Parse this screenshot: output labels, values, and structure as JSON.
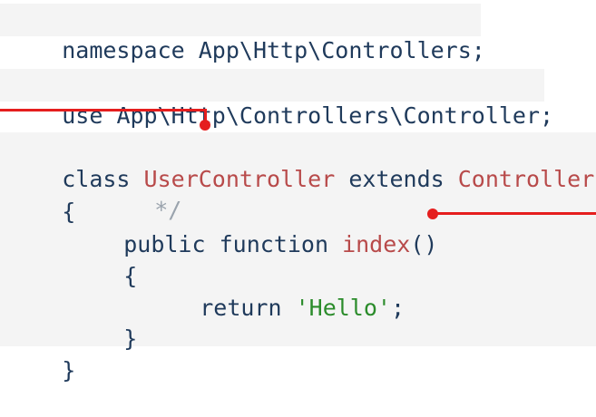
{
  "code": {
    "namespace_line": {
      "keyword": "namespace",
      "path": "App\\Http\\Controllers;"
    },
    "use_line": {
      "keyword": "use",
      "path": "App\\Http\\Controllers\\Controller;"
    },
    "class_line": {
      "keyword_class": "class",
      "class_name": "UserController",
      "keyword_extends": "extends",
      "parent_class": "Controller"
    },
    "open_brace_class": "{",
    "comment_fragment": "*/",
    "method_line": {
      "modifier": "public",
      "keyword_function": "function",
      "method_name": "index",
      "parens": "()"
    },
    "open_brace_method": "{",
    "return_line": {
      "keyword": "return",
      "string_value": "'Hello'",
      "terminator": ";"
    },
    "close_brace_method": "}",
    "close_brace_class": "}"
  },
  "colors": {
    "keyword": "#1f3a5b",
    "class_name": "#b84a4a",
    "string": "#2b8c2b",
    "comment": "#9aa3ad",
    "annotation": "#e51e1e"
  }
}
